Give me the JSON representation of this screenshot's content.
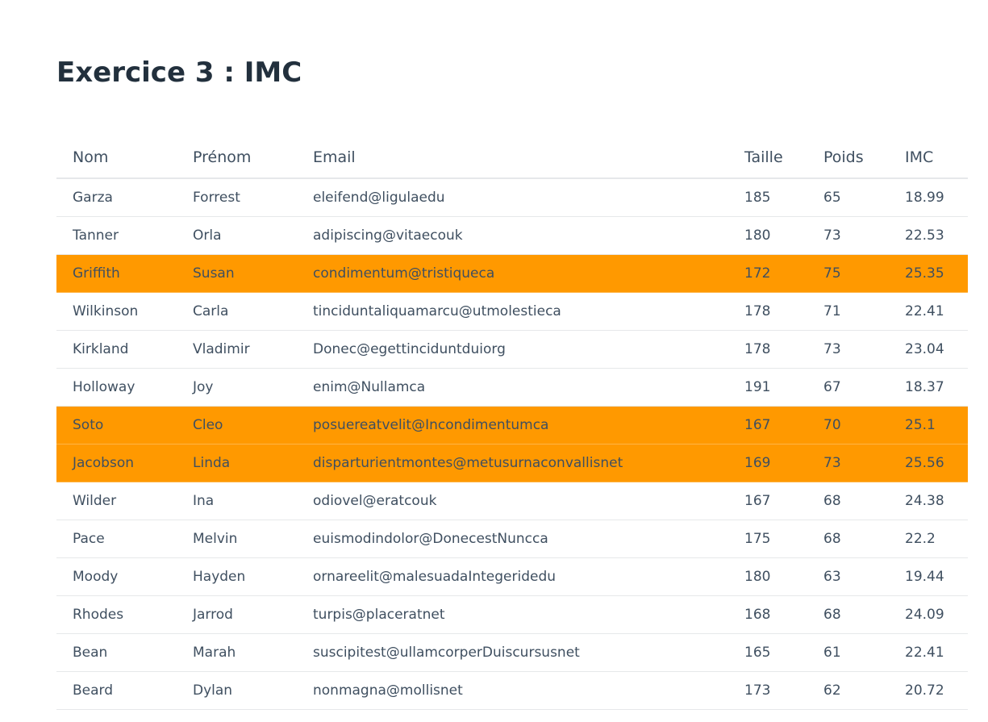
{
  "page": {
    "title": "Exercice 3 : IMC"
  },
  "colors": {
    "highlight": "#ff9900",
    "text": "#3f4f60",
    "title": "#22303d",
    "divider": "#e6e8ea"
  },
  "table": {
    "headers": [
      "Nom",
      "Prénom",
      "Email",
      "Taille",
      "Poids",
      "IMC"
    ],
    "rows": [
      {
        "nom": "Garza",
        "prenom": "Forrest",
        "email": "eleifend@ligulaedu",
        "taille": "185",
        "poids": "65",
        "imc": "18.99",
        "highlight": false
      },
      {
        "nom": "Tanner",
        "prenom": "Orla",
        "email": "adipiscing@vitaecouk",
        "taille": "180",
        "poids": "73",
        "imc": "22.53",
        "highlight": false
      },
      {
        "nom": "Griffith",
        "prenom": "Susan",
        "email": "condimentum@tristiqueca",
        "taille": "172",
        "poids": "75",
        "imc": "25.35",
        "highlight": true
      },
      {
        "nom": "Wilkinson",
        "prenom": "Carla",
        "email": "tinciduntaliquamarcu@utmolestieca",
        "taille": "178",
        "poids": "71",
        "imc": "22.41",
        "highlight": false
      },
      {
        "nom": "Kirkland",
        "prenom": "Vladimir",
        "email": "Donec@egettinciduntduiorg",
        "taille": "178",
        "poids": "73",
        "imc": "23.04",
        "highlight": false
      },
      {
        "nom": "Holloway",
        "prenom": "Joy",
        "email": "enim@Nullamca",
        "taille": "191",
        "poids": "67",
        "imc": "18.37",
        "highlight": false
      },
      {
        "nom": "Soto",
        "prenom": "Cleo",
        "email": "posuereatvelit@Incondimentumca",
        "taille": "167",
        "poids": "70",
        "imc": "25.1",
        "highlight": true
      },
      {
        "nom": "Jacobson",
        "prenom": "Linda",
        "email": "disparturientmontes@metusurnaconvallisnet",
        "taille": "169",
        "poids": "73",
        "imc": "25.56",
        "highlight": true
      },
      {
        "nom": "Wilder",
        "prenom": "Ina",
        "email": "odiovel@eratcouk",
        "taille": "167",
        "poids": "68",
        "imc": "24.38",
        "highlight": false
      },
      {
        "nom": "Pace",
        "prenom": "Melvin",
        "email": "euismodindolor@DonecestNuncca",
        "taille": "175",
        "poids": "68",
        "imc": "22.2",
        "highlight": false
      },
      {
        "nom": "Moody",
        "prenom": "Hayden",
        "email": "ornareelit@malesuadaIntegeridedu",
        "taille": "180",
        "poids": "63",
        "imc": "19.44",
        "highlight": false
      },
      {
        "nom": "Rhodes",
        "prenom": "Jarrod",
        "email": "turpis@placeratnet",
        "taille": "168",
        "poids": "68",
        "imc": "24.09",
        "highlight": false
      },
      {
        "nom": "Bean",
        "prenom": "Marah",
        "email": "suscipitest@ullamcorperDuiscursusnet",
        "taille": "165",
        "poids": "61",
        "imc": "22.41",
        "highlight": false
      },
      {
        "nom": "Beard",
        "prenom": "Dylan",
        "email": "nonmagna@mollisnet",
        "taille": "173",
        "poids": "62",
        "imc": "20.72",
        "highlight": false
      }
    ]
  }
}
